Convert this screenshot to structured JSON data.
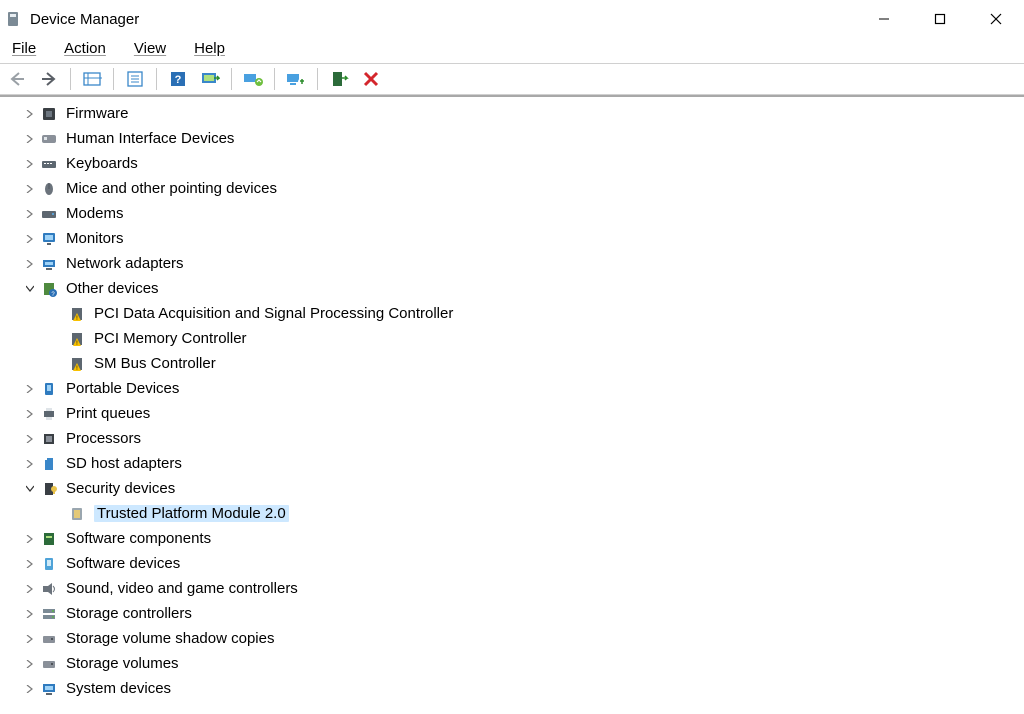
{
  "window": {
    "title": "Device Manager"
  },
  "menu": {
    "file": "File",
    "action": "Action",
    "view": "View",
    "help": "Help"
  },
  "tree": {
    "firmware": "Firmware",
    "hid": "Human Interface Devices",
    "keyboards": "Keyboards",
    "mice": "Mice and other pointing devices",
    "modems": "Modems",
    "monitors": "Monitors",
    "network": "Network adapters",
    "other": "Other devices",
    "other_pci_data": "PCI Data Acquisition and Signal Processing Controller",
    "other_pci_mem": "PCI Memory Controller",
    "other_sm": "SM Bus Controller",
    "portable": "Portable Devices",
    "print": "Print queues",
    "processors": "Processors",
    "sd": "SD host adapters",
    "security": "Security devices",
    "tpm": "Trusted Platform Module 2.0",
    "soft_comp": "Software components",
    "soft_dev": "Software devices",
    "sound": "Sound, video and game controllers",
    "storage_ctrl": "Storage controllers",
    "storage_shadow": "Storage volume shadow copies",
    "storage_vol": "Storage volumes",
    "system": "System devices"
  }
}
